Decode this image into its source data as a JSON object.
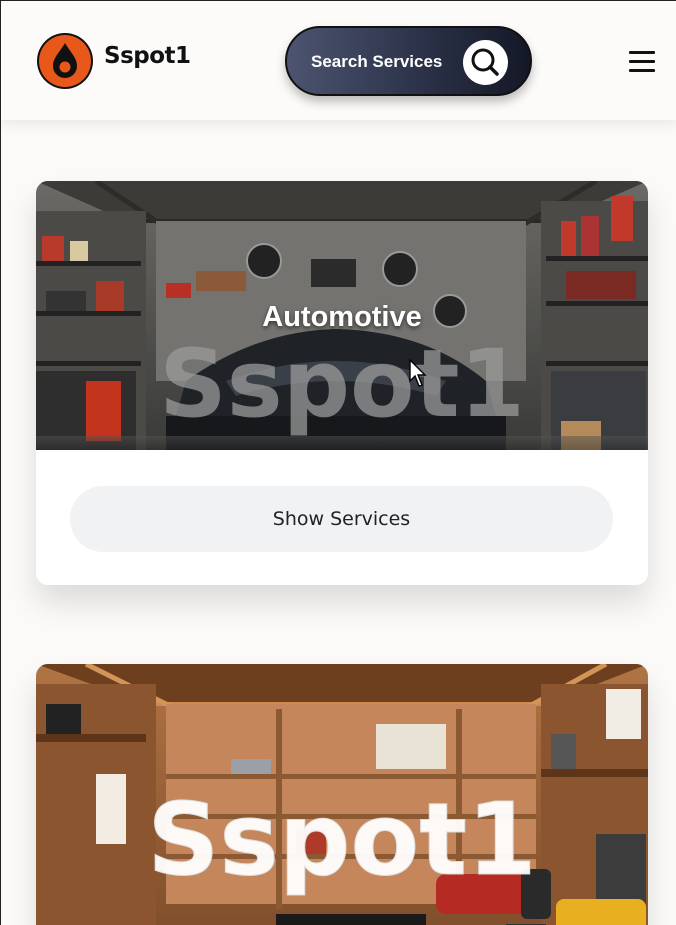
{
  "brand": {
    "name": "Sspot1",
    "icon": "flame-drop-icon"
  },
  "header": {
    "search_label": "Search Services",
    "search_icon": "search-icon",
    "menu_icon": "hamburger-menu-icon"
  },
  "cards": [
    {
      "title": "Automotive",
      "watermark": "Sspot1",
      "button_label": "Show Services",
      "image": "garage-workshop-with-car"
    },
    {
      "title": "",
      "watermark": "Sspot1",
      "image": "wooden-carpentry-workshop-with-power-tools"
    }
  ],
  "colors": {
    "accent": "#e8581a",
    "search_bg": "#2c3248",
    "button_bg": "#f1f2f4"
  }
}
